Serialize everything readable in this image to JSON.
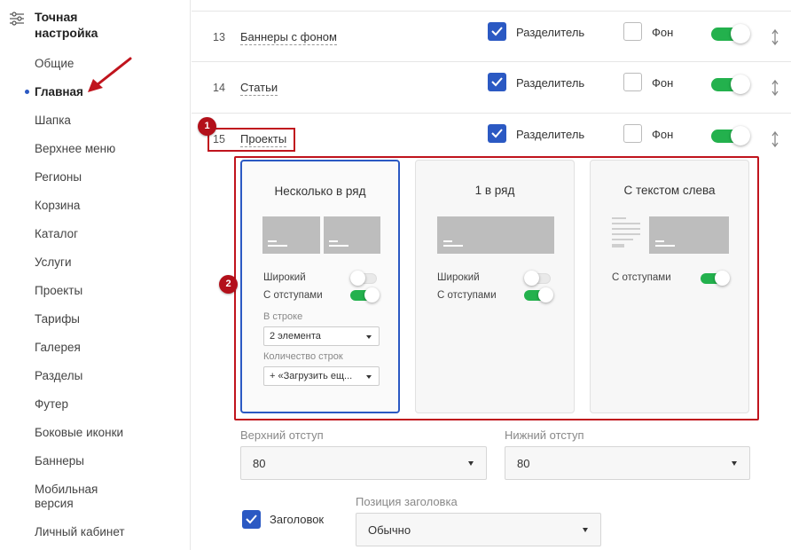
{
  "sidebar": {
    "title": "Точная настройка",
    "icon": "sliders-icon",
    "items": [
      {
        "label": "Общие"
      },
      {
        "label": "Главная",
        "active": true
      },
      {
        "label": "Шапка"
      },
      {
        "label": "Верхнее меню"
      },
      {
        "label": "Регионы"
      },
      {
        "label": "Корзина"
      },
      {
        "label": "Каталог"
      },
      {
        "label": "Услуги"
      },
      {
        "label": "Проекты"
      },
      {
        "label": "Тарифы"
      },
      {
        "label": "Галерея"
      },
      {
        "label": "Разделы"
      },
      {
        "label": "Футер"
      },
      {
        "label": "Боковые иконки"
      },
      {
        "label": "Баннеры"
      },
      {
        "label": "Мобильная версия"
      },
      {
        "label": "Личный кабинет"
      }
    ]
  },
  "rows": [
    {
      "num": "13",
      "name": "Баннеры с фоном",
      "divider_label": "Разделитель",
      "divider_checked": true,
      "bg_label": "Фон",
      "bg_checked": false,
      "enabled": true
    },
    {
      "num": "14",
      "name": "Статьи",
      "divider_label": "Разделитель",
      "divider_checked": true,
      "bg_label": "Фон",
      "bg_checked": false,
      "enabled": true
    },
    {
      "num": "15",
      "name": "Проекты",
      "divider_label": "Разделитель",
      "divider_checked": true,
      "bg_label": "Фон",
      "bg_checked": false,
      "enabled": true
    }
  ],
  "cards": [
    {
      "title": "Несколько в ряд",
      "selected": true,
      "wide_label": "Широкий",
      "wide_on": false,
      "padding_label": "С отступами",
      "padding_on": true,
      "per_row_caption": "В строке",
      "per_row_value": "2 элемента",
      "rows_caption": "Количество строк",
      "rows_value": "+ «Загрузить ещ..."
    },
    {
      "title": "1 в ряд",
      "selected": false,
      "wide_label": "Широкий",
      "wide_on": false,
      "padding_label": "С отступами",
      "padding_on": true
    },
    {
      "title": "С текстом слева",
      "selected": false,
      "padding_label": "С отступами",
      "padding_on": true
    }
  ],
  "spacing": {
    "top_label": "Верхний отступ",
    "top_value": "80",
    "bottom_label": "Нижний отступ",
    "bottom_value": "80"
  },
  "heading": {
    "checkbox_label": "Заголовок",
    "checked": true,
    "position_label": "Позиция заголовка",
    "position_value": "Обычно"
  },
  "annotations": {
    "badge1": "1",
    "badge2": "2"
  },
  "colors": {
    "accent": "#2b59c3",
    "toggle_on": "#23b14d",
    "annotation": "#c0141d"
  }
}
